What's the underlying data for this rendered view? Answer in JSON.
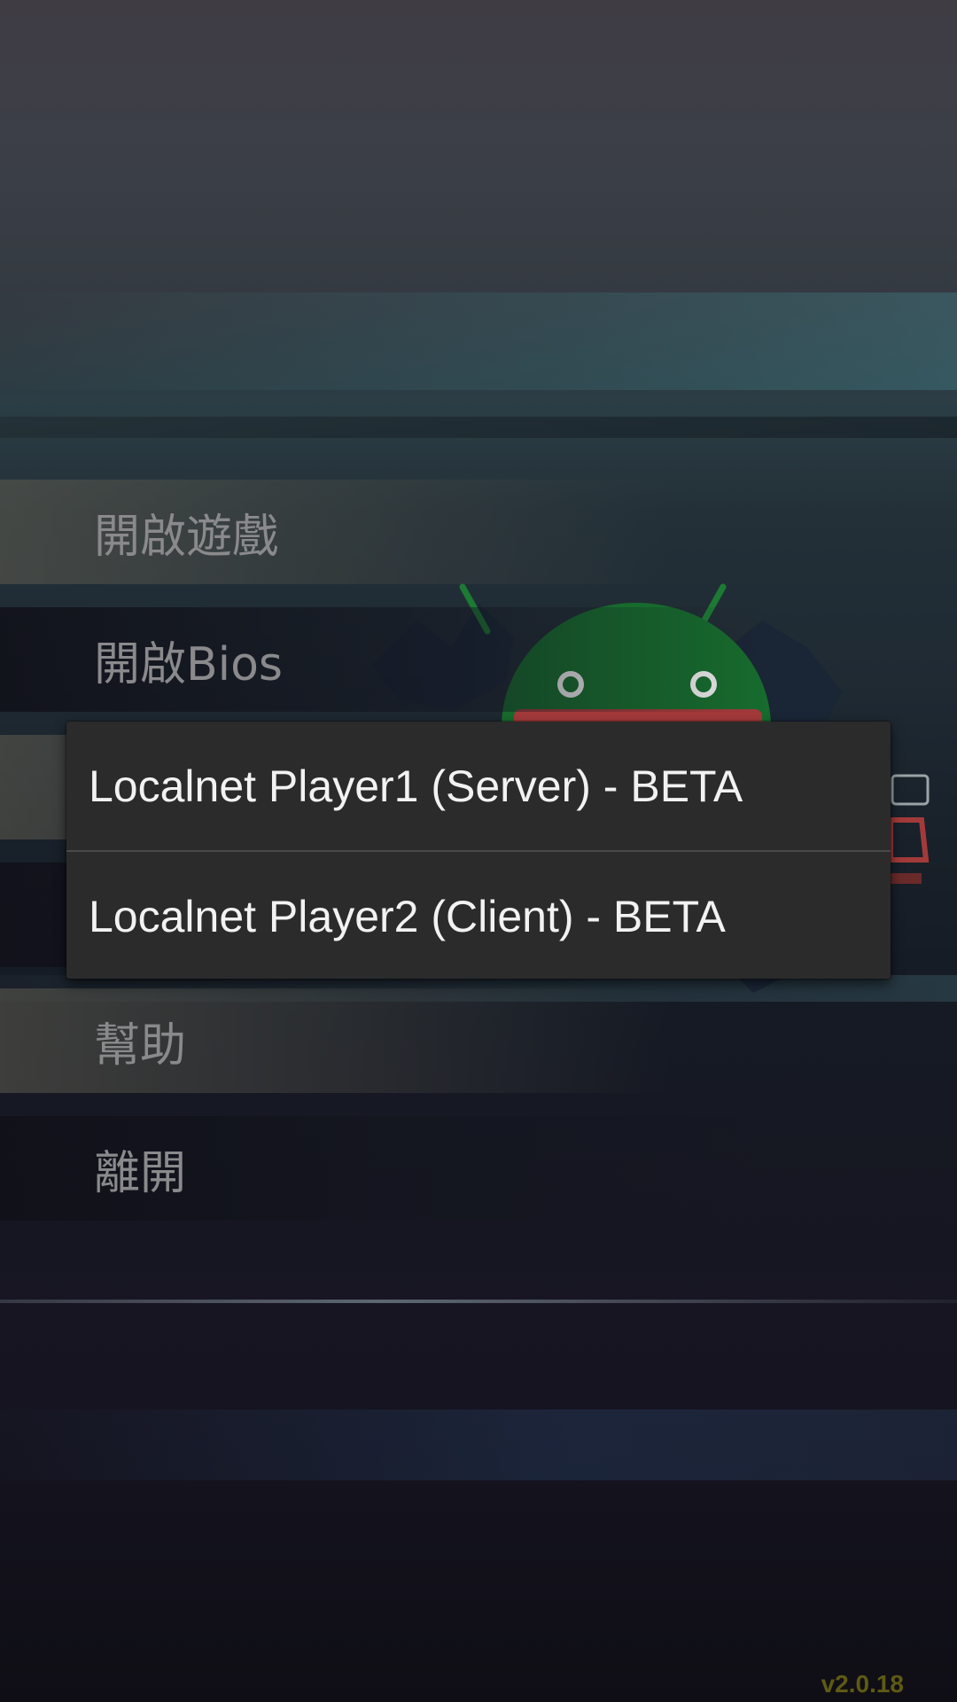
{
  "menu": {
    "items": [
      {
        "label": "開啟遊戲"
      },
      {
        "label": "開啟Bios"
      },
      {
        "label": ""
      },
      {
        "label": ""
      },
      {
        "label": "幫助"
      },
      {
        "label": "離開"
      }
    ]
  },
  "popup": {
    "options": [
      {
        "label": "Localnet Player1 (Server) - BETA"
      },
      {
        "label": "Localnet Player2 (Client) - BETA"
      }
    ]
  },
  "version": "v2.0.18",
  "colors": {
    "menu_text": "#8a8a8c",
    "popup_bg": "#2b2b2b",
    "popup_text": "#f2f2f2",
    "android_green": "#1c7a34",
    "version_text": "#5e5a14"
  },
  "icons": [
    "android-logo-icon"
  ]
}
